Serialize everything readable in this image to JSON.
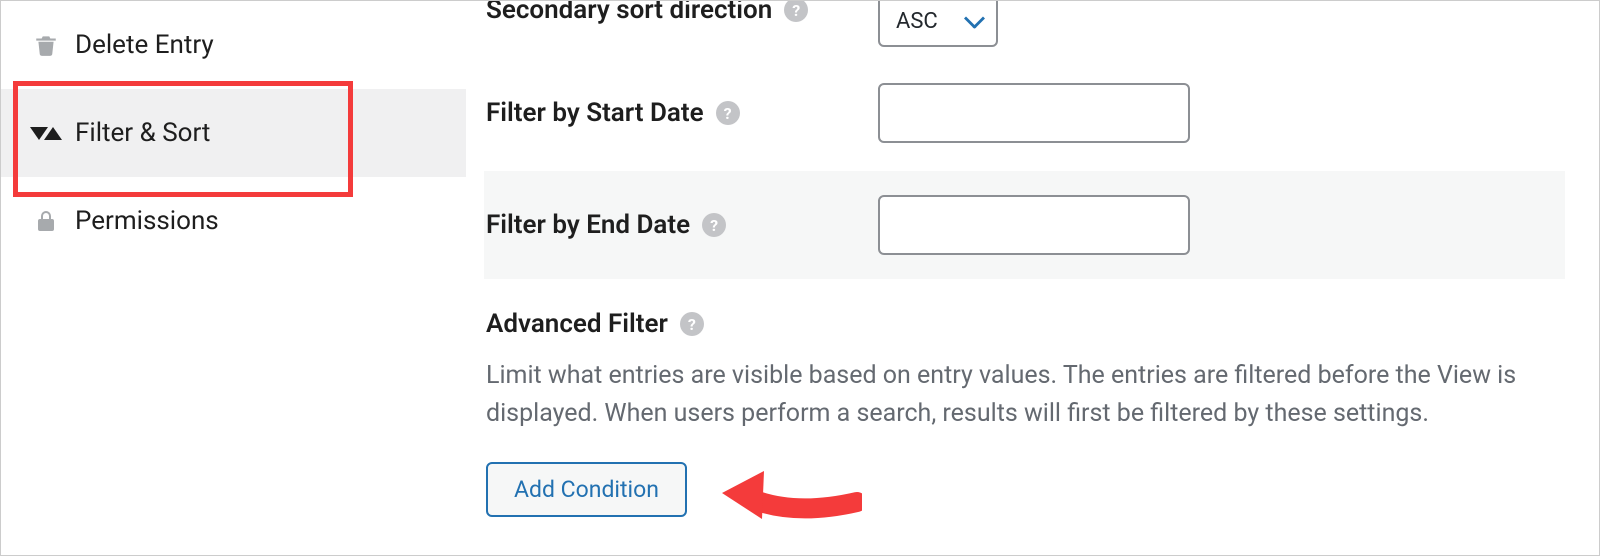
{
  "sidebar": {
    "items": [
      {
        "label": "Delete Entry"
      },
      {
        "label": "Filter & Sort"
      },
      {
        "label": "Permissions"
      }
    ]
  },
  "form": {
    "secondary_sort_direction": {
      "label": "Secondary sort direction",
      "value": "ASC"
    },
    "filter_start_date": {
      "label": "Filter by Start Date",
      "value": ""
    },
    "filter_end_date": {
      "label": "Filter by End Date",
      "value": ""
    }
  },
  "advanced": {
    "heading": "Advanced Filter",
    "description": "Limit what entries are visible based on entry values. The entries are filtered before the View is displayed. When users perform a search, results will first be filtered by these settings.",
    "add_label": "Add Condition"
  }
}
